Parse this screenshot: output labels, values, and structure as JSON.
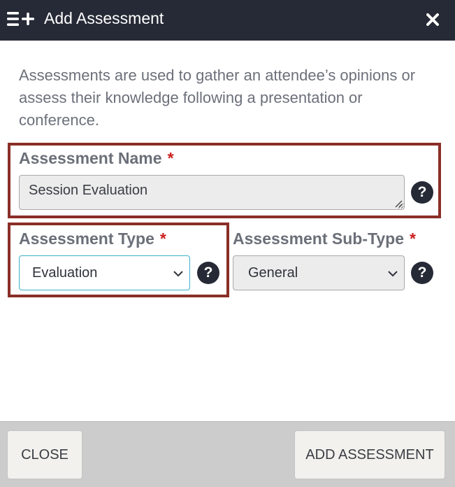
{
  "header": {
    "title": "Add Assessment",
    "icon": "list-add-icon",
    "close_icon": "close-icon"
  },
  "description": "Assessments are used to gather an attendee’s opinions or assess their knowledge following a presentation or conference.",
  "form": {
    "name_label": "Assessment Name",
    "name_value": "Session Evaluation",
    "type_label": "Assessment Type",
    "type_value": "Evaluation",
    "subtype_label": "Assessment Sub-Type",
    "subtype_value": "General",
    "required_marker": "*",
    "help_glyph": "?"
  },
  "footer": {
    "close_label": "CLOSE",
    "add_label": "ADD ASSESSMENT"
  },
  "colors": {
    "header_bg": "#262a36",
    "highlight_border": "#8a2f27",
    "required": "#cc1f1f",
    "focus_border": "#3bb2c8",
    "footer_bg": "#cccccc"
  }
}
